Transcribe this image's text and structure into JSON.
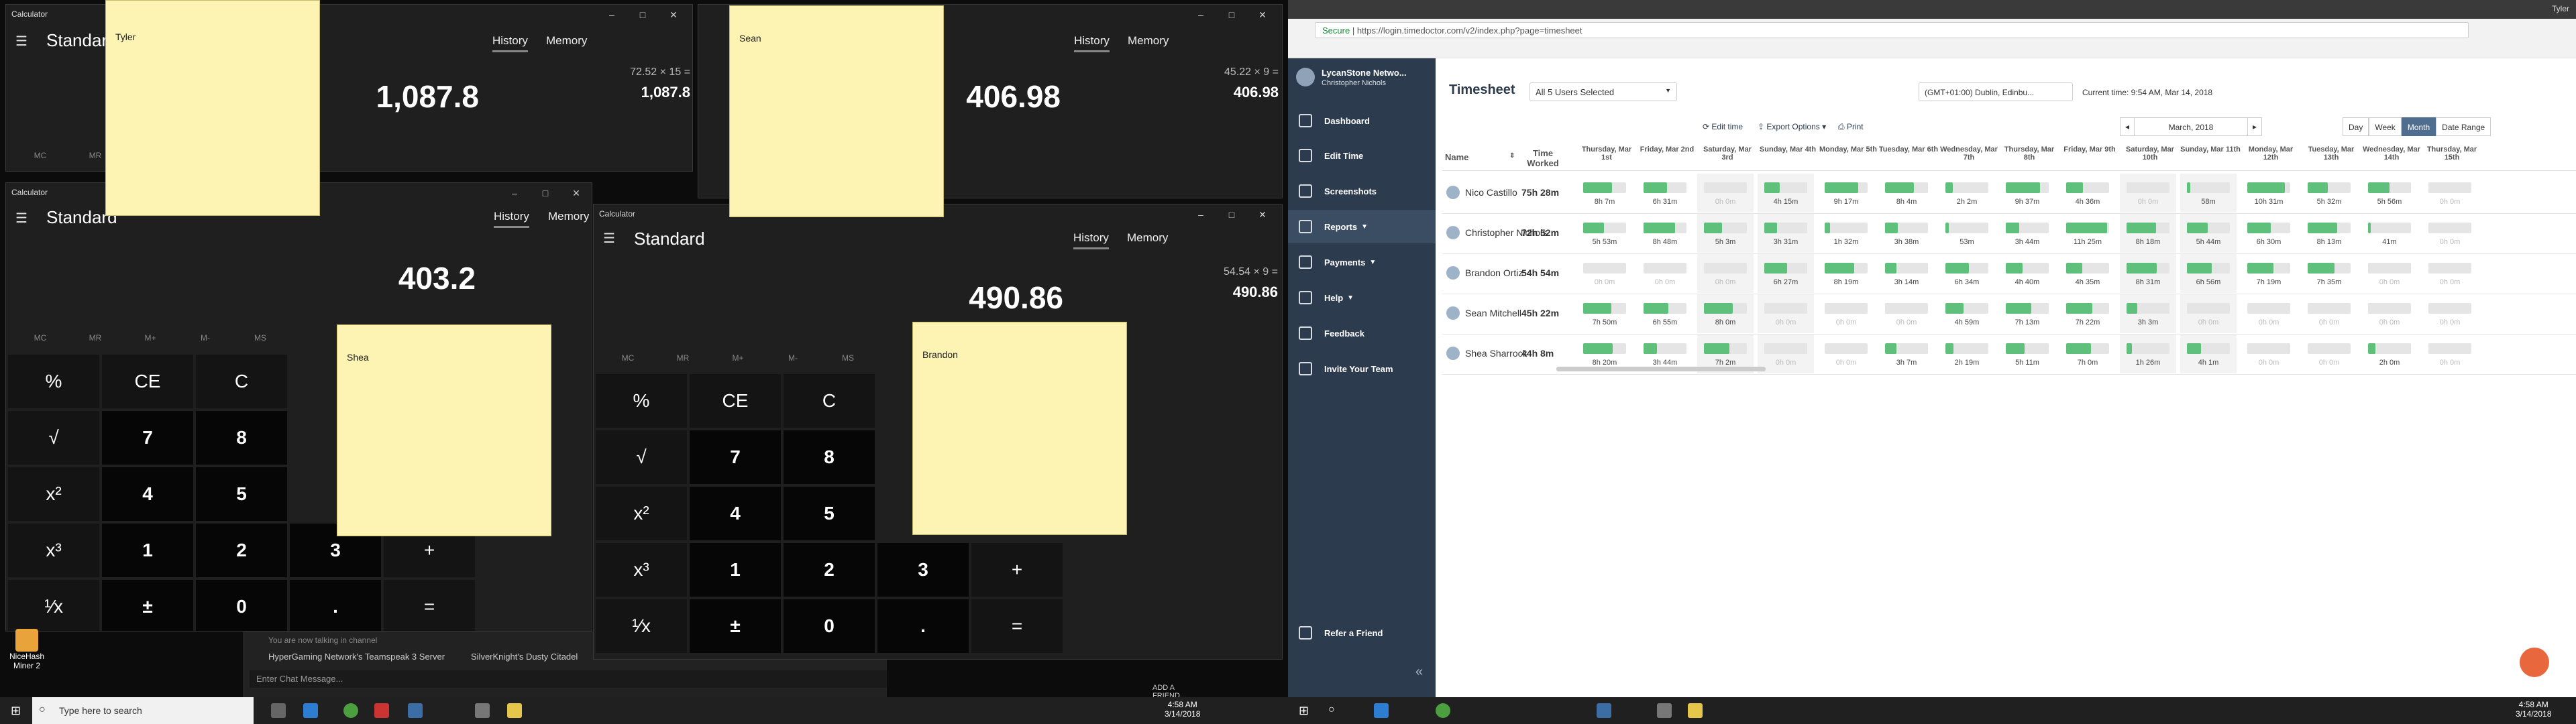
{
  "calculators": [
    {
      "title": "Calculator",
      "mode": "Standard",
      "tab_history": "History",
      "tab_memory": "Memory",
      "display": "1,087.8",
      "expression": "72.52 × 15 =",
      "history": "1,087.8"
    },
    {
      "title": "",
      "mode": "Standard",
      "tab_history": "History",
      "tab_memory": "Memory",
      "display": "406.98",
      "expression": "45.22 × 9 =",
      "history": "406.98"
    },
    {
      "title": "Calculator",
      "mode": "Standard",
      "tab_history": "History",
      "tab_memory": "Memory",
      "display": "403.2"
    },
    {
      "title": "Calculator",
      "mode": "Standard",
      "tab_history": "History",
      "tab_memory": "Memory",
      "display": "490.86",
      "expression": "54.54 × 9 =",
      "history": "490.86"
    }
  ],
  "memory_labels": [
    "MC",
    "MR",
    "M+",
    "M-",
    "MS"
  ],
  "keys": {
    "percent": "%",
    "ce": "CE",
    "c": "C",
    "sqrt": "√",
    "square": "x²",
    "cube": "x³",
    "recip": "¹⁄x",
    "plusminus": "±",
    "dot": ".",
    "equals": "=",
    "plus": "+",
    "n0": "0",
    "n1": "1",
    "n2": "2",
    "n3": "3",
    "n4": "4",
    "n5": "5",
    "n7": "7",
    "n8": "8"
  },
  "sticky_notes": [
    "Tyler",
    "Sean",
    "Shea",
    "Brandon"
  ],
  "left_taskbar": {
    "search_placeholder": "Type here to search",
    "time": "4:58 AM",
    "date": "3/14/2018"
  },
  "right_taskbar": {
    "time": "4:58 AM",
    "date": "3/14/2018"
  },
  "chat": {
    "server": "HyperGaming Network's Teamspeak 3 Server",
    "channel": "SilverKnight's Dusty Citadel",
    "message_placeholder": "Enter Chat Message...",
    "notice": "You are now talking in channel",
    "add_friend": "ADD A FRIEND..."
  },
  "desktop_icon": {
    "label": "NiceHash Miner 2"
  },
  "browser": {
    "secure": "Secure",
    "url": "https://login.timedoctor.com/v2/index.php?page=timesheet",
    "user_tab": "Tyler"
  },
  "sidebar": {
    "company": "LycanStone Netwo...",
    "user": "Christopher Nichols",
    "items": [
      "Dashboard",
      "Edit Time",
      "Screenshots",
      "Reports",
      "Payments",
      "Help",
      "Feedback",
      "Invite Your Team"
    ],
    "refer": "Refer a Friend",
    "collapse": "«"
  },
  "timesheet": {
    "title": "Timesheet",
    "users_select": "All 5 Users Selected",
    "timezone": "(GMT+01:00) Dublin, Edinbu...",
    "current_time": "Current time: 9:54 AM, Mar 14, 2018",
    "edit_time": "Edit time",
    "export": "Export Options",
    "print": "Print",
    "period": "March, 2018",
    "view_day": "Day",
    "view_week": "Week",
    "view_month": "Month",
    "view_range": "Date Range",
    "col_name": "Name",
    "col_time": "Time Worked",
    "days": [
      [
        "Thursday,",
        "Mar 1st"
      ],
      [
        "Friday,",
        "Mar 2nd"
      ],
      [
        "Saturday,",
        "Mar 3rd"
      ],
      [
        "Sunday,",
        "Mar 4th"
      ],
      [
        "Monday,",
        "Mar 5th"
      ],
      [
        "Tuesday,",
        "Mar 6th"
      ],
      [
        "Wednesday,",
        "Mar 7th"
      ],
      [
        "Thursday,",
        "Mar 8th"
      ],
      [
        "Friday,",
        "Mar 9th"
      ],
      [
        "Saturday,",
        "Mar 10th"
      ],
      [
        "Sunday,",
        "Mar 11th"
      ],
      [
        "Monday,",
        "Mar 12th"
      ],
      [
        "Tuesday,",
        "Mar 13th"
      ],
      [
        "Wednesday,",
        "Mar 14th"
      ],
      [
        "Thursday,",
        "Mar 15th"
      ]
    ],
    "rows": [
      {
        "name": "Nico Castillo",
        "total": "75h 28m",
        "cells": [
          "8h 7m",
          "6h 31m",
          "0h 0m",
          "4h 15m",
          "9h 17m",
          "8h 4m",
          "2h 2m",
          "9h 37m",
          "4h 36m",
          "0h 0m",
          "58m",
          "10h 31m",
          "5h 32m",
          "5h 56m",
          "0h 0m"
        ]
      },
      {
        "name": "Christopher Nichols",
        "total": "72h 52m",
        "cells": [
          "5h 53m",
          "8h 48m",
          "5h 3m",
          "3h 31m",
          "1h 32m",
          "3h 38m",
          "53m",
          "3h 44m",
          "11h 25m",
          "8h 18m",
          "5h 44m",
          "6h 30m",
          "8h 13m",
          "41m",
          "0h 0m"
        ]
      },
      {
        "name": "Brandon Ortiz",
        "total": "54h 54m",
        "cells": [
          "0h 0m",
          "0h 0m",
          "0h 0m",
          "6h 27m",
          "8h 19m",
          "3h 14m",
          "6h 34m",
          "4h 40m",
          "4h 35m",
          "8h 31m",
          "6h 56m",
          "7h 19m",
          "7h 35m",
          "0h 0m",
          "0h 0m"
        ]
      },
      {
        "name": "Sean Mitchell",
        "total": "45h 22m",
        "cells": [
          "7h 50m",
          "6h 55m",
          "8h 0m",
          "0h 0m",
          "0h 0m",
          "0h 0m",
          "4h 59m",
          "7h 13m",
          "7h 22m",
          "3h 3m",
          "0h 0m",
          "0h 0m",
          "0h 0m",
          "0h 0m",
          "0h 0m"
        ]
      },
      {
        "name": "Shea Sharrock",
        "total": "44h 8m",
        "cells": [
          "8h 20m",
          "3h 44m",
          "7h 2m",
          "0h 0m",
          "0h 0m",
          "3h 7m",
          "2h 19m",
          "5h 11m",
          "7h 0m",
          "1h 26m",
          "4h 1m",
          "0h 0m",
          "0h 0m",
          "2h 0m",
          "0h 0m"
        ]
      }
    ]
  },
  "colors": {
    "accent": "#5ec07a",
    "sidebar": "#2c3b4e",
    "sticky": "#fdf3b3",
    "chat_bubble": "#e8673c"
  }
}
